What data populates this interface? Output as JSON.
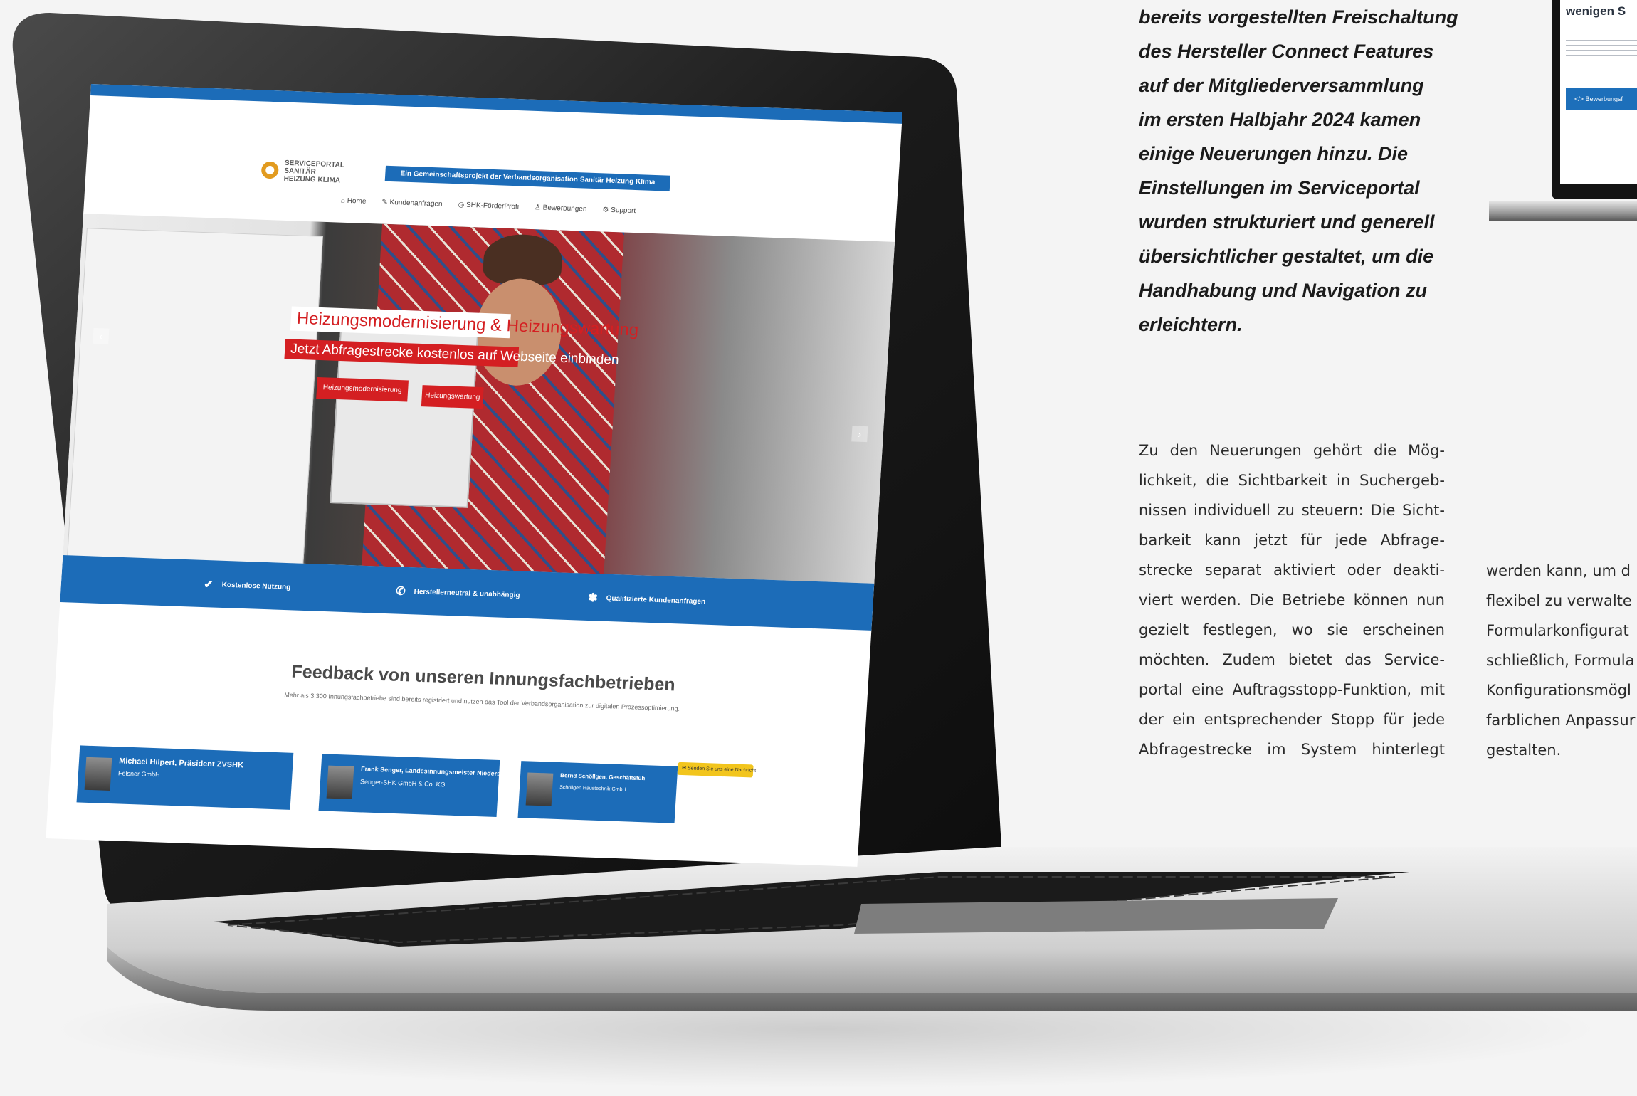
{
  "article": {
    "lead_lines": [
      "bereits vorgestellten Freischaltung",
      "des Hersteller Connect Features",
      "auf der Mitgliederversammlung",
      "im ersten Halbjahr 2024 kamen",
      "einige Neuerungen hinzu. Die",
      "Einstellungen im Serviceportal",
      "wurden strukturiert und generell",
      "übersichtlicher gestaltet, um die",
      "Handhabung und Navigation zu",
      "erleichtern."
    ],
    "body_lines": [
      "Zu den Neuerungen gehört die Mög-",
      "lichkeit, die Sichtbarkeit in Suchergeb-",
      "nissen individuell zu steuern: Die Sicht-",
      "barkeit kann jetzt für jede Abfrage-",
      "strecke separat aktiviert oder deakti-",
      "viert werden. Die Betriebe können nun",
      "gezielt festlegen, wo sie erscheinen",
      "möchten. Zudem bietet das Service-",
      "portal eine Auftragsstopp-Funktion, mit",
      "der ein entsprechender Stopp für jede",
      "Abfragestrecke im System hinterlegt"
    ],
    "body2_lines": [
      "werden kann, um d",
      "flexibel zu verwalte",
      "Formularkonfigurat",
      "schließlich, Formula",
      "Konfigurationsmögl",
      "farblichen Anpassur",
      "gestalten."
    ]
  },
  "mini_device": {
    "title": "wenigen S",
    "button_label": "</> Bewerbungsf"
  },
  "website": {
    "logo_lines": [
      "SERVICEPORTAL",
      "SANITÄR",
      "HEIZUNG KLIMA"
    ],
    "tagline": "Ein Gemeinschaftsprojekt der Verbandsorganisation Sanitär Heizung Klima",
    "nav": [
      "⌂ Home",
      "✎ Kundenanfragen",
      "◎ SHK-FörderProfi",
      "♙ Bewerbungen",
      "⚙ Support"
    ],
    "hero": {
      "headline": "Heizungsmodernisierung & Heizungswartung",
      "subline": "Jetzt Abfragestrecke kostenlos auf Webseite einbinden",
      "button1": "Heizungsmodernisierung",
      "button2": "Heizungswartung",
      "arrow_left": "‹",
      "arrow_right": "›"
    },
    "features": [
      {
        "icon": "✔",
        "label": "Kostenlose Nutzung"
      },
      {
        "icon": "✆",
        "label": "Herstellerneutral & unabhängig"
      },
      {
        "icon": "✽",
        "label": "Qualifizierte Kundenanfragen"
      }
    ],
    "feedback_title": "Feedback von unseren Innungsfachbetrieben",
    "feedback_subtitle": "Mehr als 3.300 Innungsfachbetriebe sind bereits registriert und nutzen das Tool der Verbandsorganisation zur digitalen Prozessoptimierung.",
    "cards": [
      {
        "name": "Michael Hilpert, Präsident ZVSHK",
        "company": "Felsner GmbH"
      },
      {
        "name": "Frank Senger, Landesinnungsmeister Niedersachsen",
        "company": "Senger-SHK GmbH & Co. KG"
      },
      {
        "name": "Bernd Schöllgen, Geschäftsfüh",
        "company": "Schöllgen Haustechnik GmbH"
      }
    ],
    "message_pill": "✉ Senden Sie uns eine Nachricht"
  }
}
